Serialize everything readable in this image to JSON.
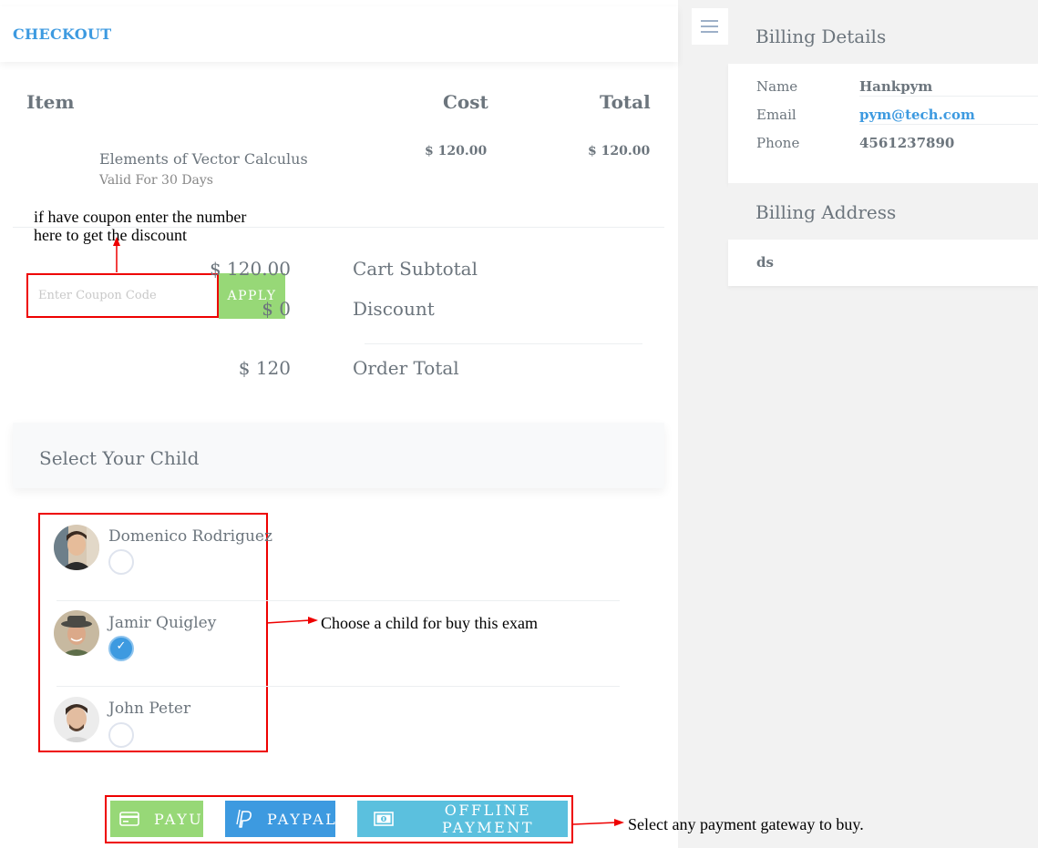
{
  "header": {
    "title": "CHECKOUT"
  },
  "table": {
    "col_item": "Item",
    "col_cost": "Cost",
    "col_total": "Total",
    "row": {
      "name": "Elements of Vector Calculus",
      "validity": "Valid For 30 Days",
      "cost": "$ 120.00",
      "total": "$ 120.00"
    }
  },
  "coupon": {
    "placeholder": "Enter Coupon Code",
    "value": "",
    "apply_label": "APPLY"
  },
  "summary": {
    "subtotal_label": "Cart Subtotal",
    "subtotal_value": "$ 120.00",
    "discount_label": "Discount",
    "discount_value": "$ 0",
    "order_total_label": "Order Total",
    "order_total_value": "$ 120"
  },
  "children": {
    "title": "Select Your Child",
    "items": [
      {
        "name": "Domenico Rodriguez",
        "selected": false
      },
      {
        "name": "Jamir Quigley",
        "selected": true
      },
      {
        "name": "John Peter",
        "selected": false
      }
    ]
  },
  "payment": {
    "buttons": [
      {
        "label": "PAYU",
        "icon": "credit-card-icon",
        "color": "#97d877"
      },
      {
        "label": "PAYPAL",
        "icon": "paypal-icon",
        "color": "#3d9ae0"
      },
      {
        "label": "OFFLINE PAYMENT",
        "icon": "cash-icon",
        "color": "#5bc0de"
      }
    ]
  },
  "annotations": {
    "coupon_line1": "if have coupon enter the number",
    "coupon_line2": "here to get the discount",
    "child": "Choose a child for buy this exam",
    "payment": "Select any payment gateway to buy."
  },
  "billing_details": {
    "title": "Billing Details",
    "name_label": "Name",
    "name_value": "Hankpym",
    "email_label": "Email",
    "email_value": "pym@tech.com",
    "phone_label": "Phone",
    "phone_value": "4561237890"
  },
  "billing_address": {
    "title": "Billing Address",
    "value": "ds"
  },
  "colors": {
    "accent": "#3d9ae0",
    "annotation_red": "#e00000"
  }
}
